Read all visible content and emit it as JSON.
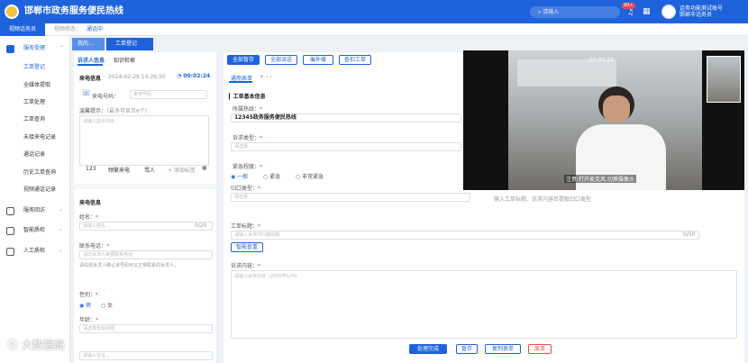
{
  "header": {
    "title": "邯郸市政务服务便民热线",
    "search_placeholder": "请输入",
    "badge": "99+",
    "user_line1": "话务功能测试账号",
    "user_line2": "邯郸市话务员"
  },
  "status": {
    "tag": "视频话务员",
    "label": "视频状态：",
    "value": "通话中"
  },
  "sidebar": {
    "groups": [
      {
        "label": "服务受理",
        "icon": "service-icon"
      },
      {
        "label": "服务回访",
        "icon": "visit-icon"
      },
      {
        "label": "智能质检",
        "icon": "quality-icon"
      },
      {
        "label": "人工质检",
        "icon": "manual-icon"
      }
    ],
    "items": [
      "工单登记",
      "全媒体提取",
      "工单处理",
      "工单查询",
      "未接来电记录",
      "通话记录",
      "历史工单查询",
      "视频通话记录"
    ]
  },
  "tabs": [
    "我的...",
    "工单登记"
  ],
  "left": {
    "tab1": "诉求人信息",
    "tab2": "知识检索",
    "call_info": "来电信息",
    "call_time": "2024-02-29 14:26:50",
    "duration": "00:02:24",
    "caller_no_label": "来电号码：",
    "caller_no_placeholder": "来电号码",
    "hint_label": "温馨提示：",
    "hint_sub": "（最多可显示6个）",
    "hint_placeholder": "请输入提示内容",
    "chips": [
      "123",
      "频繁来电",
      "骂人"
    ],
    "add_chip": "+ 添加标签",
    "caller_section": "来电信息",
    "name_label": "姓名：",
    "name_placeholder": "请输入姓名...",
    "name_count": "0/20",
    "phone_label": "联系电话：",
    "phone_placeholder": "请向诉求人索要联系电话",
    "phone_note": "请勾选诉求人确认该号码可以正常联系的诉求人。",
    "gender_label": "性别：",
    "male": "男",
    "female": "女",
    "age_label": "年龄：",
    "age_placeholder": "请选择年龄范围",
    "addr_placeholder": "请输入住址..."
  },
  "toolbar": {
    "b1": "全部暂存",
    "b2": "全部派送",
    "b3": "催补缓",
    "b4": "查扣工单"
  },
  "form": {
    "subtab": "通用表单",
    "section": "工单基本信息",
    "line_label": "所属热线：",
    "line_value": "12345政务服务便民热线",
    "type_label": "诉求类型：",
    "type_placeholder": "请选择",
    "urgency_label": "紧急程度：",
    "u1": "一般",
    "u2": "紧急",
    "u3": "非常紧急",
    "category_label": "归口类型：",
    "category_placeholder": "请选择",
    "category_hint": "输入工单标题、诉求内容后提取归口类型",
    "title_label": "工单标题：",
    "title_placeholder": "请输入诉求归口或标题",
    "title_count": "0/50",
    "smart_btn": "智能查重",
    "content_label": "诉求内容：",
    "content_placeholder": "请输入诉求内容（2000字以内）"
  },
  "video": {
    "timer": "00:00:29",
    "caption": "注意:打开麦克风,切换摄像头"
  },
  "bottom": {
    "b1": "处理完成",
    "b2": "暂存",
    "b3": "复制表单",
    "b4": "废单"
  },
  "watermark": "大数据局"
}
